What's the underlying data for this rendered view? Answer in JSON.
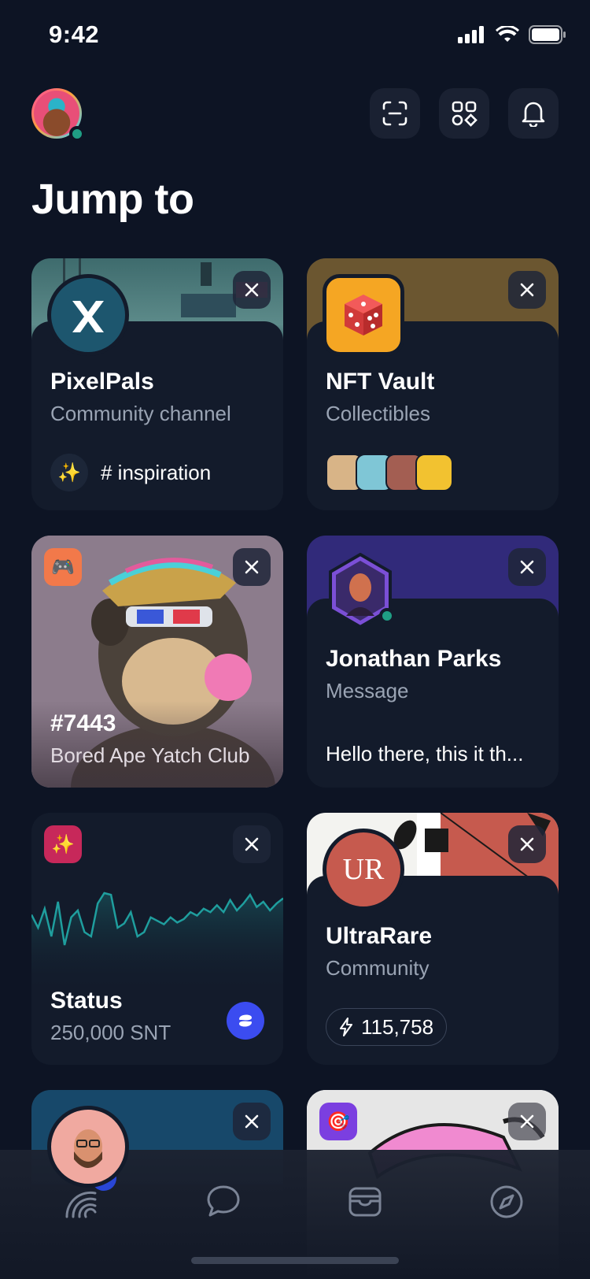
{
  "status_bar": {
    "time": "9:42"
  },
  "header": {
    "title": "Jump to"
  },
  "cards": {
    "pixelpals": {
      "title": "PixelPals",
      "subtitle": "Community channel",
      "channel": "# inspiration",
      "channel_emoji": "✨",
      "banner_color": "#4f7c7e"
    },
    "nft_vault": {
      "title": "NFT Vault",
      "subtitle": "Collectibles",
      "banner_color": "#6b5630",
      "icon_color": "#f5a623"
    },
    "bored_ape": {
      "title": "#7443",
      "subtitle": "Bored Ape Yatch Club",
      "icon_emoji": "🎮",
      "background_color": "#8a7a8a"
    },
    "jonathan": {
      "title": "Jonathan Parks",
      "subtitle": "Message",
      "preview": "Hello there, this it th...",
      "banner_color": "#312a7a"
    },
    "status": {
      "title": "Status",
      "subtitle": "250,000 SNT",
      "icon_emoji": "✨",
      "chart_points": [
        55,
        40,
        62,
        30,
        70,
        20,
        52,
        60,
        35,
        30,
        68,
        80,
        78,
        40,
        45,
        58,
        30,
        35,
        52,
        48,
        44,
        52,
        46,
        50,
        58,
        54,
        62,
        58,
        66,
        58,
        72,
        60,
        68,
        78,
        64,
        70,
        60,
        68,
        74
      ]
    },
    "ultrarare": {
      "title": "UltraRare",
      "subtitle": "Community",
      "logo_text": "UR",
      "count": "115,758",
      "logo_color": "#c65a4e"
    },
    "person": {
      "banner_color": "#17486a"
    },
    "pink_art": {
      "icon_emoji": "🎯"
    }
  },
  "tab_bar": {
    "items": [
      {
        "name": "home",
        "icon": "rainbow-icon"
      },
      {
        "name": "chat",
        "icon": "chat-bubble-icon"
      },
      {
        "name": "wallet",
        "icon": "wallet-icon"
      },
      {
        "name": "browser",
        "icon": "compass-icon"
      }
    ],
    "badge_count": "5"
  }
}
